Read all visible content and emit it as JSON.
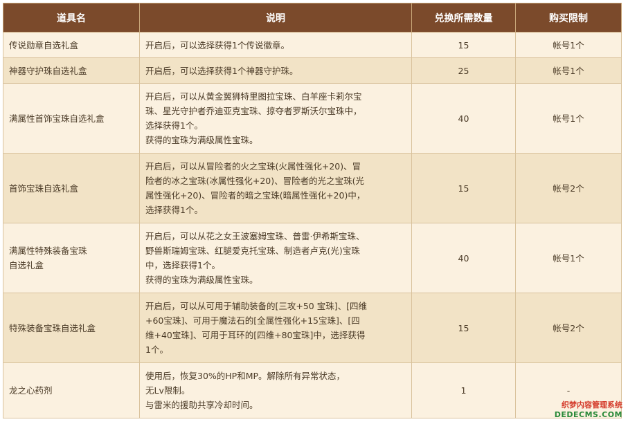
{
  "table": {
    "headers": [
      "道具名",
      "说明",
      "兑换所需数量",
      "购买限制"
    ],
    "rows": [
      {
        "name": "传说勋章自选礼盒",
        "desc": "开启后，可以选择获得1个传说徽章。",
        "qty": "15",
        "limit": "帐号1个"
      },
      {
        "name": "神器守护珠自选礼盒",
        "desc": "开启后，可以选择获得1个神器守护珠。",
        "qty": "25",
        "limit": "帐号1个"
      },
      {
        "name": "满属性首饰宝珠自选礼盒",
        "desc": "开启后，可以从黄金翼狮特里图拉宝珠、白羊座卡莉尔宝\n珠、星光守护者乔迪亚克宝珠、掠夺者罗斯沃尔宝珠中，\n选择获得1个。\n获得的宝珠为满级属性宝珠。",
        "qty": "40",
        "limit": "帐号1个"
      },
      {
        "name": "首饰宝珠自选礼盒",
        "desc": "开启后，可以从冒险者的火之宝珠(火属性强化+20)、冒\n险者的冰之宝珠(冰属性强化+20)、冒险者的光之宝珠(光\n属性强化+20)、冒险者的暗之宝珠(暗属性强化+20)中，\n选择获得1个。",
        "qty": "15",
        "limit": "帐号2个"
      },
      {
        "name": "满属性特殊装备宝珠\n自选礼盒",
        "desc": "开启后，可以从花之女王波塞姆宝珠、普雷·伊希斯宝珠、\n野兽斯瑞姆宝珠、红腿爱克托宝珠、制造者卢克(光)宝珠\n中，选择获得1个。\n获得的宝珠为满级属性宝珠。",
        "qty": "40",
        "limit": "帐号1个"
      },
      {
        "name": "特殊装备宝珠自选礼盒",
        "desc": "开启后，可以从可用于辅助装备的[三攻+50 宝珠]、[四维\n+60宝珠]、可用于魔法石的[全属性强化+15宝珠]、[四\n维+40宝珠]、可用于耳环的[四维+80宝珠]中，选择获得\n1个。",
        "qty": "15",
        "limit": "帐号2个"
      },
      {
        "name": "龙之心药剂",
        "desc": "使用后，恢复30%的HP和MP。解除所有异常状态，\n无Lv限制。\n与雷米的援助共享冷却时间。",
        "qty": "1",
        "limit": "-"
      }
    ]
  },
  "watermark": {
    "text_cn": "织梦内容管理系统",
    "text_url": "DEDECMS.COM"
  }
}
